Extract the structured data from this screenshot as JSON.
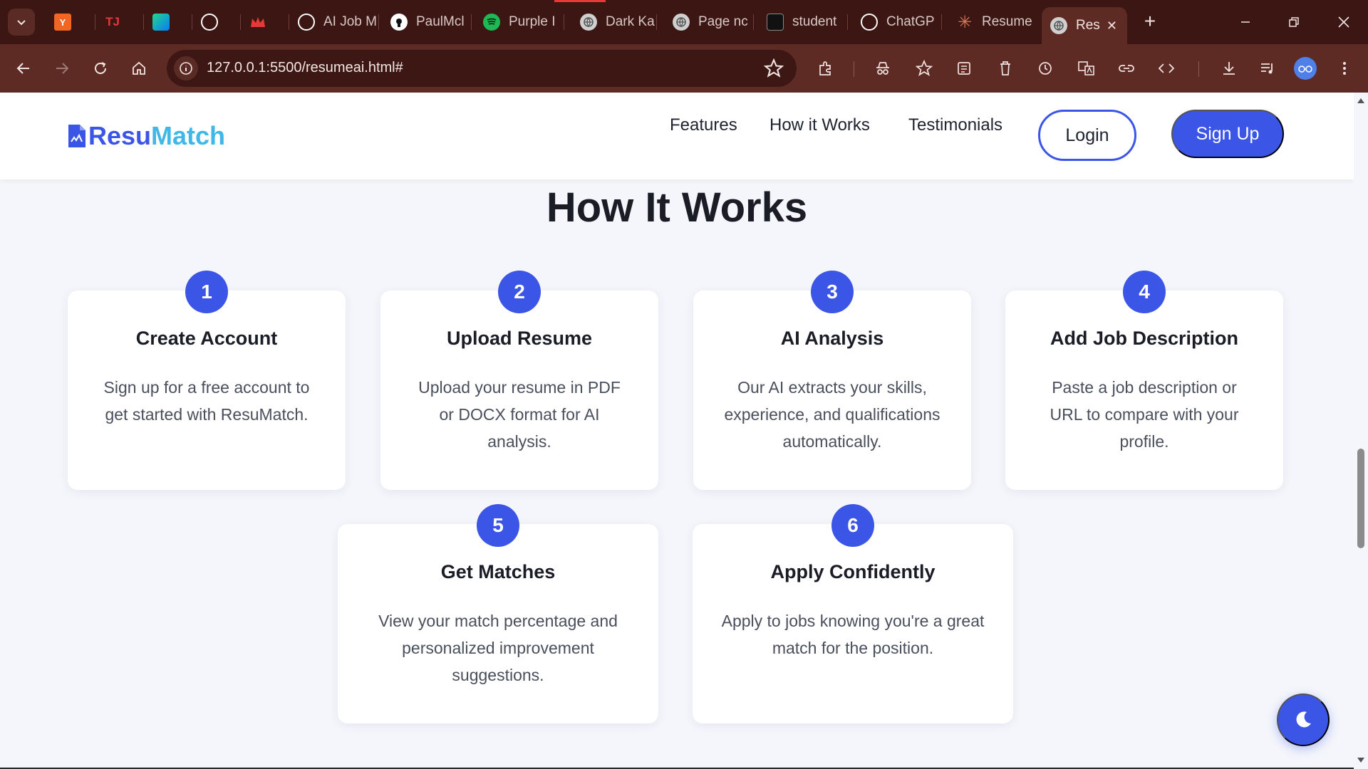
{
  "browser": {
    "tabs": [
      {
        "label": "",
        "icon": "y-combinator-icon",
        "color": "#f26522"
      },
      {
        "label": "",
        "icon": "tj-logo-icon",
        "color": "#c62828"
      },
      {
        "label": "",
        "icon": "pycharm-icon",
        "color": "#21d789"
      },
      {
        "label": "",
        "icon": "openai-icon",
        "color": "#ffffff"
      },
      {
        "label": "",
        "icon": "crown-icon",
        "color": "#e53935"
      },
      {
        "label": "AI Job M",
        "icon": "openai-icon",
        "color": "#ffffff"
      },
      {
        "label": "PaulMcl",
        "icon": "github-icon",
        "color": "#ffffff"
      },
      {
        "label": "Purple I",
        "icon": "spotify-icon",
        "color": "#1db954"
      },
      {
        "label": "Dark Ka",
        "icon": "globe-icon",
        "color": "#cfcfcf"
      },
      {
        "label": "Page nc",
        "icon": "globe-icon",
        "color": "#cfcfcf"
      },
      {
        "label": "student",
        "icon": "student-site-icon",
        "color": "#111111"
      },
      {
        "label": "ChatGP",
        "icon": "openai-icon",
        "color": "#ffffff"
      },
      {
        "label": "Resume",
        "icon": "claude-icon",
        "color": "#d97757"
      },
      {
        "label": "Res",
        "icon": "globe-icon",
        "color": "#cfcfcf"
      }
    ],
    "url": "127.0.0.1:5500/resumeai.html#"
  },
  "site": {
    "logo": {
      "part1": "Resu",
      "part2": "Match"
    },
    "nav": {
      "features": "Features",
      "how_it_works": "How it Works",
      "testimonials": "Testimonials",
      "login": "Login",
      "signup": "Sign Up"
    },
    "section_title": "How It Works",
    "steps": [
      {
        "number": "1",
        "title": "Create Account",
        "desc": "Sign up for a free account to get started with ResuMatch."
      },
      {
        "number": "2",
        "title": "Upload Resume",
        "desc": "Upload your resume in PDF or DOCX format for AI analysis."
      },
      {
        "number": "3",
        "title": "AI Analysis",
        "desc": "Our AI extracts your skills, experience, and qualifications automatically."
      },
      {
        "number": "4",
        "title": "Add Job Description",
        "desc": "Paste a job description or URL to compare with your profile."
      },
      {
        "number": "5",
        "title": "Get Matches",
        "desc": "View your match percentage and personalized improvement suggestions."
      },
      {
        "number": "6",
        "title": "Apply Confidently",
        "desc": "Apply to jobs knowing you're a great match for the position."
      }
    ],
    "colors": {
      "primary": "#3b55e6",
      "accent": "#3fb8e8",
      "background": "#f4f6fb"
    }
  }
}
